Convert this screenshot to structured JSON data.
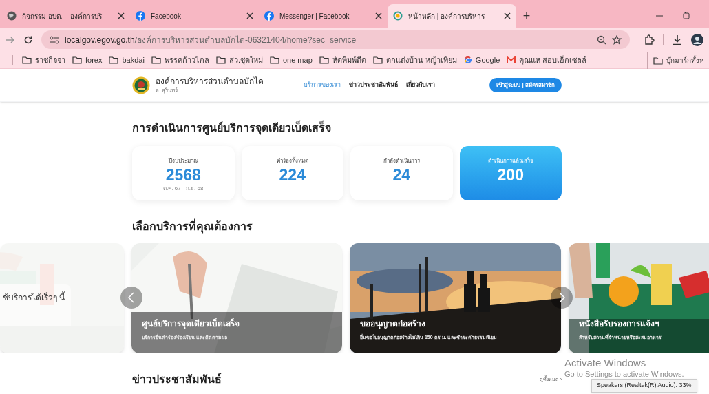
{
  "browser": {
    "tabs": [
      {
        "kind": "site",
        "title": "กิจกรรม อบต. – องค์การบริ",
        "selected": false
      },
      {
        "kind": "facebook",
        "title": "Facebook",
        "selected": false
      },
      {
        "kind": "facebook",
        "title": "Messenger | Facebook",
        "selected": false
      },
      {
        "kind": "loading",
        "title": "หน้าหลัก | องค์การบริหาร",
        "selected": true
      }
    ],
    "new_tab": "+",
    "address": {
      "host": "localgov.egov.go.th",
      "path": "/องค์การบริหารส่วนตำบลบักได-06321404/home?sec=service"
    },
    "bookmarks": [
      {
        "kind": "folder",
        "label": "ราชกิจจา"
      },
      {
        "kind": "folder",
        "label": "forex"
      },
      {
        "kind": "folder",
        "label": "bakdai"
      },
      {
        "kind": "folder",
        "label": "พรรคก้าวไกล"
      },
      {
        "kind": "folder",
        "label": "สว.ชุดใหม่"
      },
      {
        "kind": "folder",
        "label": "one map"
      },
      {
        "kind": "folder",
        "label": "หัดพิมพ์ดีด"
      },
      {
        "kind": "folder",
        "label": "ตกแต่งบ้าน หญ้าเทียม"
      },
      {
        "kind": "google",
        "label": "Google"
      },
      {
        "kind": "gmail",
        "label": "คุณแห สอบเอ็กเซลล์"
      }
    ],
    "all_bookmarks": "บุ๊กมาร์กทั้งห"
  },
  "site": {
    "name": "องค์การบริหารส่วนตำบลบักได",
    "district": "อ. สุรินทร์",
    "nav": [
      {
        "label": "บริการของเรา",
        "selected": true
      },
      {
        "label": "ข่าวประชาสัมพันธ์",
        "selected": false
      },
      {
        "label": "เกี่ยวกับเรา",
        "selected": false
      }
    ],
    "login": "เข้าสู่ระบบ | สมัครสมาชิก"
  },
  "stats": {
    "title": "การดำเนินการศูนย์บริการจุดเดียวเบ็ดเสร็จ",
    "cards": [
      {
        "label": "ปีงบประมาณ",
        "value": "2568",
        "note": "ต.ค. 67 - ก.ย. 68",
        "highlighted": false
      },
      {
        "label": "คำร้องทั้งหมด",
        "value": "224",
        "highlighted": false
      },
      {
        "label": "กำลังดำเนินการ",
        "value": "24",
        "highlighted": false
      },
      {
        "label": "ดำเนินการแล้วเสร็จ",
        "value": "200",
        "highlighted": true
      }
    ]
  },
  "services": {
    "title": "เลือกบริการที่คุณต้องการ",
    "cards": [
      {
        "kind": "coming",
        "title": "ช้บริการได้เร็วๆ นี้"
      },
      {
        "kind": "document",
        "title": "ศูนย์บริการจุดเดียวเบ็ดเสร็จ",
        "subtitle": "บริการยื่นคำร้อง/ร้องเรียน และติดตามผล"
      },
      {
        "kind": "construction",
        "title": "ขออนุญาตก่อสร้าง",
        "subtitle": "ยื่นขอใบอนุญาตก่อสร้างไม่เกิน 150 ตร.ม. และชำระค่าธรรมเนียม"
      },
      {
        "kind": "food",
        "title": "หนังสือรับรองการแจ้งฯ",
        "subtitle": "สำหรับสถานที่จำหน่ายหรือสะสมอาหาร"
      }
    ]
  },
  "news": {
    "title": "ข่าวประชาสัมพันธ์",
    "view_all": "ดูทั้งหมด",
    "view_all_arrow": "›"
  },
  "os": {
    "activate_title": "Activate Windows",
    "activate_text": "Go to Settings to activate Windows.",
    "volume_tooltip": "Speakers (Realtek(R) Audio): 33%"
  }
}
